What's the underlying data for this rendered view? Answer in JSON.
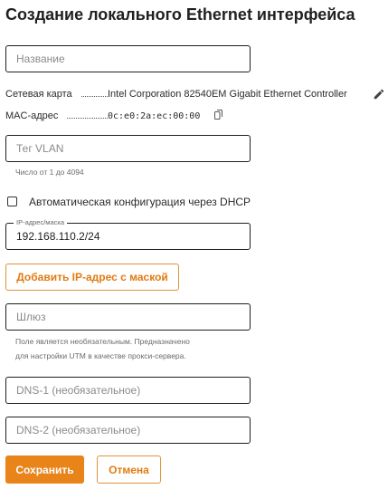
{
  "page": {
    "title": "Создание локального Ethernet интерфейса"
  },
  "fields": {
    "name": {
      "placeholder": "Название",
      "value": ""
    },
    "vlan": {
      "placeholder": "Тег VLAN",
      "value": "",
      "hint": "Число от 1 до 4094"
    },
    "ip": {
      "label": "IP-адрес/маска",
      "value": "192.168.110.2/24"
    },
    "gateway": {
      "placeholder": "Шлюз",
      "value": "",
      "hint_line1": "Поле является необязательным. Предназначено",
      "hint_line2": "для настройки UTM в качестве прокси-сервера."
    },
    "dns1": {
      "placeholder": "DNS-1 (необязательное)",
      "value": ""
    },
    "dns2": {
      "placeholder": "DNS-2 (необязательное)",
      "value": ""
    }
  },
  "info": {
    "network_card_label": "Сетевая карта",
    "network_card_value": "Intel Corporation 82540EM Gigabit Ethernet Controller",
    "mac_label": "MAC-адрес",
    "mac_value": "0c:e0:2a:ec:00:00"
  },
  "dhcp": {
    "label": "Автоматическая конфигурация через DHCP",
    "checked": false
  },
  "buttons": {
    "add_ip": "Добавить IP-адрес с маской",
    "save": "Сохранить",
    "cancel": "Отмена"
  },
  "icons": {
    "edit": "pencil-icon",
    "copy": "copy-icon"
  },
  "colors": {
    "accent": "#e8841a",
    "accent_text": "#e07b12",
    "border": "#1f1f1f"
  }
}
